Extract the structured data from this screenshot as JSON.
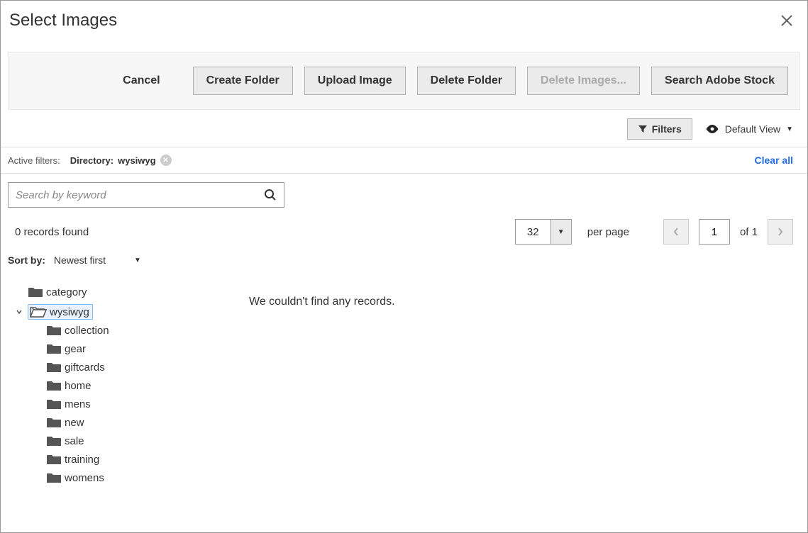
{
  "modal": {
    "title": "Select Images"
  },
  "toolbar": {
    "cancel": "Cancel",
    "create_folder": "Create Folder",
    "upload_image": "Upload Image",
    "delete_folder": "Delete Folder",
    "delete_images": "Delete Images...",
    "search_stock": "Search Adobe Stock"
  },
  "view": {
    "filters_btn": "Filters",
    "default_view": "Default View"
  },
  "filters": {
    "label": "Active filters:",
    "tag_key": "Directory:",
    "tag_value": "wysiwyg",
    "clear_all": "Clear all"
  },
  "search": {
    "placeholder": "Search by keyword"
  },
  "records": {
    "found": "0 records found"
  },
  "paging": {
    "per_page_value": "32",
    "per_page_label": "per page",
    "current": "1",
    "of_total": "of 1"
  },
  "sort": {
    "label": "Sort by:",
    "value": "Newest first"
  },
  "tree": {
    "category": "category",
    "wysiwyg": "wysiwyg",
    "children": [
      "collection",
      "gear",
      "giftcards",
      "home",
      "mens",
      "new",
      "sale",
      "training",
      "womens"
    ]
  },
  "results": {
    "empty": "We couldn't find any records."
  }
}
